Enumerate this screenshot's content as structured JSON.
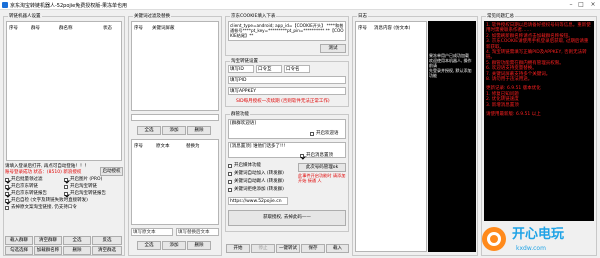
{
  "window": {
    "title": "京东淘宝转链机器人-52pojie免费授权版-果冻单也用"
  },
  "left": {
    "group_title": "转链机器人设置",
    "table_headers": [
      "序号",
      "群号",
      "群名称",
      "状态"
    ],
    "status_line_1": "请填入登录后打开, 再点可自动登陆！！！",
    "status_line_2": "账号登录成功 状态：(8510) 新浪授权",
    "login_link": "启动授权",
    "options": [
      {
        "label": "开启批量领过滤",
        "checked": true
      },
      {
        "label": "开启图片 (PRO)",
        "checked": true
      },
      {
        "label": "开启京东转链",
        "checked": true
      },
      {
        "label": "开启淘宝转链",
        "checked": false
      },
      {
        "label": "开启京东转链报告",
        "checked": true
      },
      {
        "label": "开启淘宝转链报告",
        "checked": true
      },
      {
        "label": "开启自检 (文字及转链失败时直接转发)",
        "checked": true
      },
      {
        "label": "去掉原文案淘宝链接, 仍支持口令",
        "checked": false
      }
    ],
    "btn_row1": [
      "载入群聊",
      "清空群聊",
      "全选",
      "反选"
    ],
    "btn_row2": [
      "勾选选择",
      "加载群名称",
      "删除",
      "清空群选"
    ]
  },
  "middle": {
    "group_title": "关键词过滤及替换",
    "table1_headers": [
      "序号",
      "关键词屏蔽"
    ],
    "row_btns_1": [
      "全选",
      "添加",
      "删除"
    ],
    "table2_headers": [
      "序号",
      "原文本",
      "替换为"
    ],
    "row_btns_2": [
      "全选",
      "添加",
      "删除"
    ],
    "bottom_placeholders": [
      "填写原文本",
      "填写替换后文本"
    ]
  },
  "jd": {
    "group_title": "京东COOKIE填入下表",
    "cookie_text": "client_type=android; app_id=【COOKIE开头】 ****和普通帐号****pt_key=*********pt_pin=********** **【COOKIE结尾】**",
    "test_btn": "测试",
    "tb_group": "淘宝转链设置",
    "tb_fields": [
      "填写ID",
      "口令互",
      "口令名"
    ],
    "tb_pid": "填写PID",
    "tb_appkey": "填写APPKEY",
    "tb_warning": "SID每月授权一次续期 (否则软件无法正常工作)",
    "send_group": "群管功能",
    "send_placeholder": "[群群欢迎语]",
    "welcome_cb": "开启欢迎语",
    "reply_text": "[消息置顶] 谁他们话多了!!!",
    "reply_cb": "开启消息置顶",
    "sub_options": [
      "开启媒体功能",
      "关键词自动加入 (转发群)",
      "关键词自动踢人 (转发群)",
      "关键词拒绝添加 (转发群)"
    ],
    "link_text": "https://www.52pojie.cn",
    "side_btn": "此次号码管理ok",
    "side_text": "此事件开启功能时 请添加 开始 接通 人",
    "get_btn": "获取授权, 去掉此码——",
    "bottom_btns": [
      "开始",
      "停止",
      "一键转试",
      "保存",
      "载入"
    ]
  },
  "log": {
    "title": "日志",
    "headers": [
      "序号",
      "消息内容 (仿文本)"
    ],
    "black_lines": [
      "果冻单用户已成功加载",
      "欢迎使用本机器人, 操作前请",
      "先登录并授权, 默认添加功能"
    ]
  },
  "faq": {
    "title": "常见问题汇总",
    "lines": [
      "1. 软件授权日期以后请备好授权号码等信息。重新使用时需要联系作者……",
      "2. 如需刷新群名称请点击加载群名称按钮。",
      "3. 京东COOKIE请使用手机登录后获取, 过期后请重新获取。",
      "4. 淘宝转链需填写正确PID及APPKEY, 否则无法转链。",
      "5. 群管功能需在群内拥有管理员权限。",
      "6. 欢迎语支持变量替换。",
      "7. 关键词屏蔽支持多个关键词。",
      "8. 请勿用于违法用途。",
      "更新记录: 6.9.51 版本优化",
      "1. 修复已知问题",
      "2. 优化转链速度",
      "3. 新增消息置顶",
      "请使用最新版: 6.9.51 以上"
    ]
  },
  "watermark": {
    "brand": "开心电玩",
    "url": "kxdw.com"
  }
}
